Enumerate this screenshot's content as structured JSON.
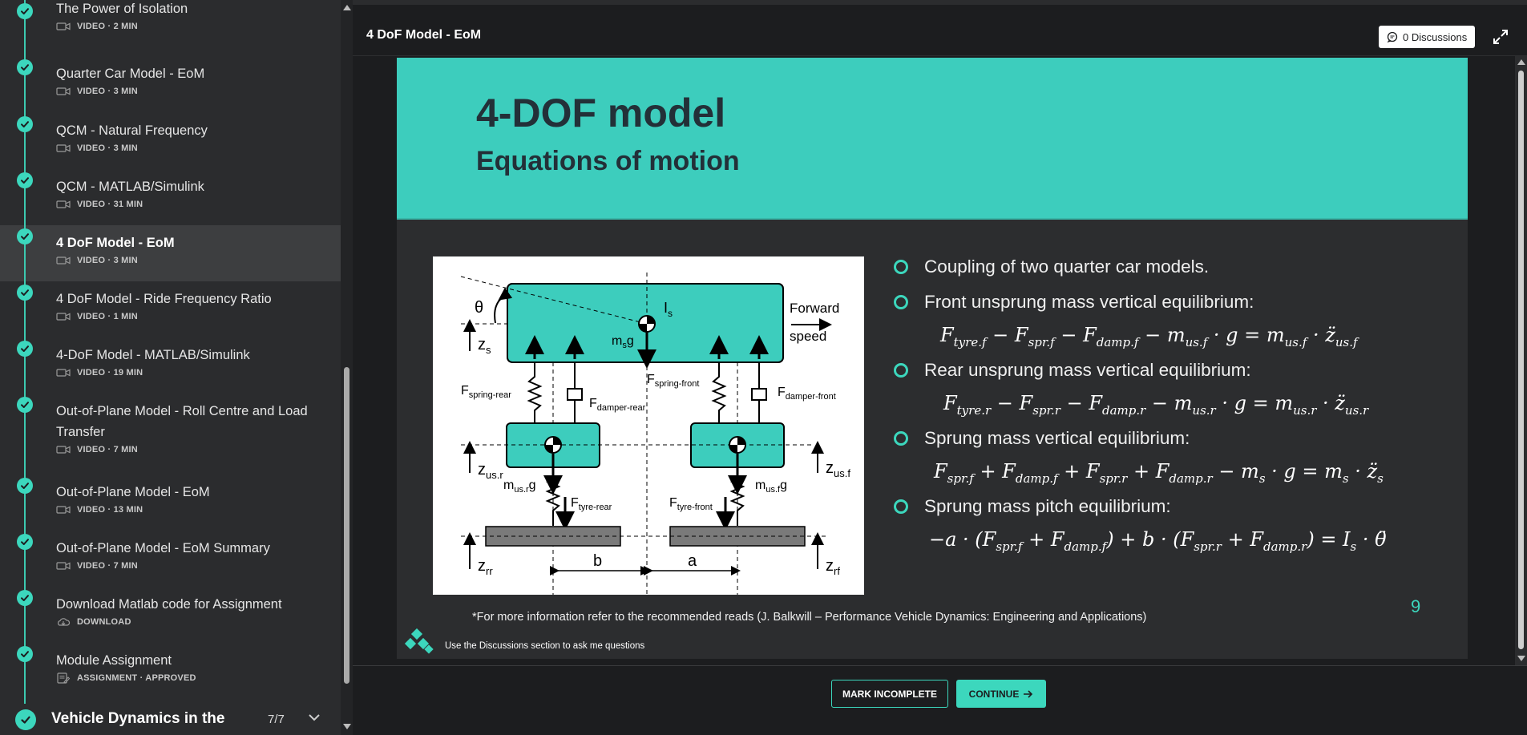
{
  "colors": {
    "accent": "#3cd7bd",
    "slide_header": "#3dcdbd",
    "sidebar_bg": "#2b2c2e",
    "main_bg": "#1c1d1f"
  },
  "sidebar": {
    "items": [
      {
        "title": "The Power of Isolation",
        "meta": "VIDEO · 2 MIN",
        "icon": "video-icon"
      },
      {
        "title": "Quarter Car Model - EoM",
        "meta": "VIDEO · 3 MIN",
        "icon": "video-icon"
      },
      {
        "title": "QCM - Natural Frequency",
        "meta": "VIDEO · 3 MIN",
        "icon": "video-icon"
      },
      {
        "title": "QCM - MATLAB/Simulink",
        "meta": "VIDEO · 31 MIN",
        "icon": "video-icon"
      },
      {
        "title": "4 DoF Model - EoM",
        "meta": "VIDEO · 3 MIN",
        "icon": "video-icon",
        "active": true
      },
      {
        "title": "4 DoF Model - Ride Frequency Ratio",
        "meta": "VIDEO · 1 MIN",
        "icon": "video-icon"
      },
      {
        "title": "4-DoF Model - MATLAB/Simulink",
        "meta": "VIDEO · 19 MIN",
        "icon": "video-icon"
      },
      {
        "title": "Out-of-Plane Model - Roll Centre and Load Transfer",
        "meta": "VIDEO · 7 MIN",
        "icon": "video-icon"
      },
      {
        "title": "Out-of-Plane Model - EoM",
        "meta": "VIDEO · 13 MIN",
        "icon": "video-icon"
      },
      {
        "title": "Out-of-Plane Model - EoM Summary",
        "meta": "VIDEO · 7 MIN",
        "icon": "video-icon"
      },
      {
        "title": "Download Matlab code for Assignment",
        "meta": "DOWNLOAD",
        "icon": "download-icon"
      },
      {
        "title": "Module Assignment",
        "meta": "ASSIGNMENT · APPROVED",
        "icon": "assignment-icon"
      }
    ],
    "module": {
      "title": "Vehicle Dynamics in the",
      "count": "7/7"
    }
  },
  "header": {
    "title": "4 DoF Model - EoM",
    "discussions_label": "0 Discussions"
  },
  "slide": {
    "title": "4-DOF model",
    "subtitle": "Equations of motion",
    "bullets": [
      "Coupling of two quarter car models.",
      "Front unsprung mass vertical equilibrium:",
      "Rear unsprung mass vertical equilibrium:",
      "Sprung mass vertical equilibrium:",
      "Sprung mass pitch equilibrium:"
    ],
    "footnote": "*For more information refer to the recommended reads (J. Balkwill – Performance Vehicle Dynamics: Engineering and Applications)",
    "page_number": "9",
    "tip": "Use the Discussions section to ask me questions",
    "diagram": {
      "theta": "θ",
      "zs": "z",
      "zs_sub": "s",
      "Is": "I",
      "Is_sub": "s",
      "msg": "m",
      "msg_sub": "s",
      "msg_g": "g",
      "forward": "Forward",
      "speed": "speed",
      "spring_rear": "F",
      "spring_rear_sub": "spring-rear",
      "damper_rear": "F",
      "damper_rear_sub": "damper-rear",
      "spring_front": "F",
      "spring_front_sub": "spring-front",
      "damper_front": "F",
      "damper_front_sub": "damper-front",
      "zusr": "z",
      "zusr_sub": "us.r",
      "zusf": "z",
      "zusf_sub": "us.f",
      "musr": "m",
      "musr_sub": "us.r",
      "musr_g": "g",
      "musf": "m",
      "musf_sub": "us.f",
      "musf_g": "g",
      "tyre_rear": "F",
      "tyre_rear_sub": "tyre-rear",
      "tyre_front": "F",
      "tyre_front_sub": "tyre-front",
      "zrr": "z",
      "zrr_sub": "rr",
      "zrf": "z",
      "zrf_sub": "rf",
      "b": "b",
      "a": "a"
    }
  },
  "footer": {
    "mark_incomplete": "MARK INCOMPLETE",
    "continue": "CONTINUE"
  }
}
